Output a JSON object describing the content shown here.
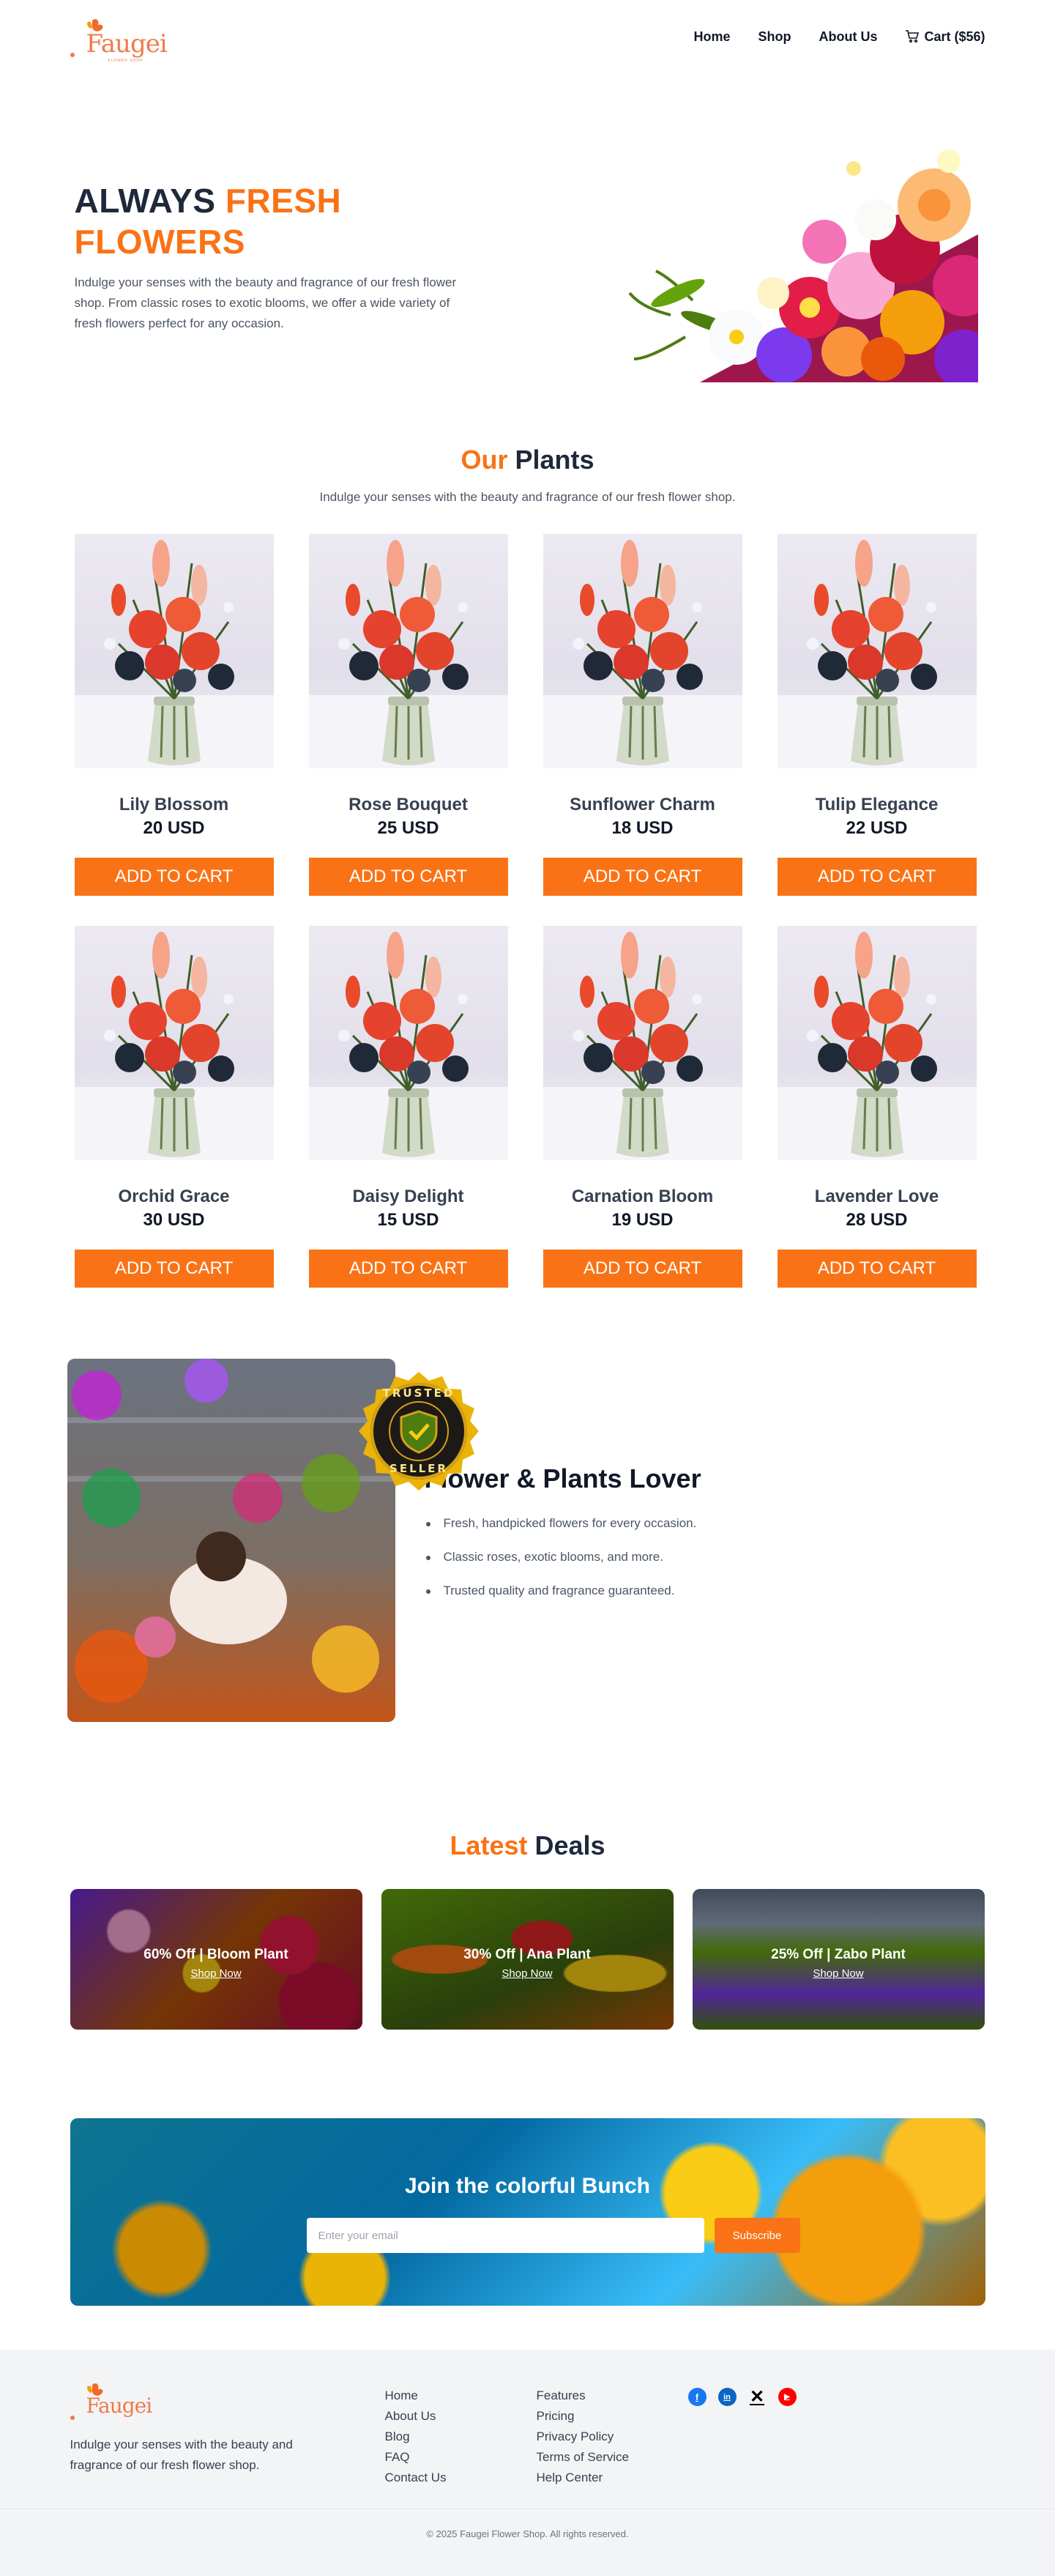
{
  "brand": {
    "name": "Faugei",
    "tagline": "FLOWER SHOP"
  },
  "nav": {
    "home": "Home",
    "shop": "Shop",
    "about": "About Us",
    "cart": "Cart ($56)"
  },
  "hero": {
    "title_line1": "ALWAYS",
    "title_accent": "FRESH",
    "title_line2": "FLOWERS",
    "description": "Indulge your senses with the beauty and fragrance of our fresh flower shop. From classic roses to exotic blooms, we offer a wide variety of fresh flowers perfect for any occasion."
  },
  "plants": {
    "title_accent": "Our",
    "title_rest": "Plants",
    "subtitle": "Indulge your senses with the beauty and fragrance of our fresh flower shop.",
    "button_label": "ADD TO CART",
    "items": [
      {
        "name": "Lily Blossom",
        "price": "20 USD"
      },
      {
        "name": "Rose Bouquet",
        "price": "25 USD"
      },
      {
        "name": "Sunflower Charm",
        "price": "18 USD"
      },
      {
        "name": "Tulip Elegance",
        "price": "22 USD"
      },
      {
        "name": "Orchid Grace",
        "price": "30 USD"
      },
      {
        "name": "Daisy Delight",
        "price": "15 USD"
      },
      {
        "name": "Carnation Bloom",
        "price": "19 USD"
      },
      {
        "name": "Lavender Love",
        "price": "28 USD"
      }
    ]
  },
  "lover": {
    "badge_top": "TRUSTED",
    "badge_bottom": "SELLER",
    "title": "Flower & Plants Lover",
    "points": [
      "Fresh, handpicked flowers for every occasion.",
      "Classic roses, exotic blooms, and more.",
      "Trusted quality and fragrance guaranteed."
    ]
  },
  "deals": {
    "title_accent": "Latest",
    "title_rest": "Deals",
    "items": [
      {
        "title": "60% Off | Bloom Plant",
        "link": "Shop Now"
      },
      {
        "title": "30% Off | Ana Plant",
        "link": "Shop Now"
      },
      {
        "title": "25% Off | Zabo Plant",
        "link": "Shop Now"
      }
    ]
  },
  "subscribe": {
    "title": "Join the colorful Bunch",
    "placeholder": "Enter your email",
    "button": "Subscribe"
  },
  "footer": {
    "description": "Indulge your senses with the beauty and fragrance of our fresh flower shop.",
    "col1": [
      "Home",
      "About Us",
      "Blog",
      "FAQ",
      "Contact Us"
    ],
    "col2": [
      "Features",
      "Pricing",
      "Privacy Policy",
      "Terms of Service",
      "Help Center"
    ],
    "socials": [
      "facebook-icon",
      "linkedin-icon",
      "x-icon",
      "youtube-icon"
    ],
    "copyright": "© 2025 Faugei Flower Shop. All rights reserved."
  },
  "colors": {
    "accent": "#f97316",
    "heading": "#1e293b",
    "footer_bg": "#f3f4f6"
  }
}
